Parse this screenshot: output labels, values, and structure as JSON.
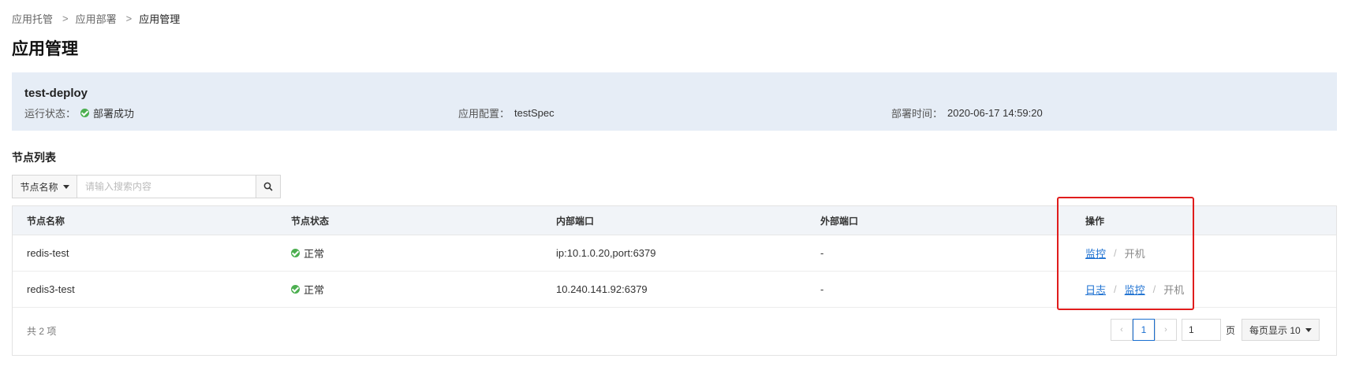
{
  "breadcrumb": {
    "items": [
      "应用托管",
      "应用部署"
    ],
    "separator": ">",
    "current": "应用管理"
  },
  "page_title": "应用管理",
  "summary": {
    "app_name": "test-deploy",
    "status_label": "运行状态：",
    "status_value": "部署成功",
    "config_label": "应用配置：",
    "config_value": "testSpec",
    "time_label": "部署时间：",
    "time_value": "2020-06-17 14:59:20"
  },
  "node_list": {
    "title": "节点列表",
    "search_field": "节点名称",
    "search_placeholder": "请输入搜索内容",
    "columns": [
      "节点名称",
      "节点状态",
      "内部端口",
      "外部端口",
      "操作"
    ],
    "rows": [
      {
        "name": "redis-test",
        "status": "正常",
        "internal_port": "ip:10.1.0.20,port:6379",
        "external_port": "-",
        "actions": [
          {
            "label": "监控",
            "enabled": true
          },
          {
            "label": "开机",
            "enabled": false
          }
        ]
      },
      {
        "name": "redis3-test",
        "status": "正常",
        "internal_port": "10.240.141.92:6379",
        "external_port": "-",
        "actions": [
          {
            "label": "日志",
            "enabled": true
          },
          {
            "label": "监控",
            "enabled": true
          },
          {
            "label": "开机",
            "enabled": false
          }
        ]
      }
    ],
    "action_separator": "/",
    "total_text": "共 2 项"
  },
  "pagination": {
    "prev": "‹",
    "current": "1",
    "next": "›",
    "jump_value": "1",
    "page_label": "页",
    "page_size_text": "每页显示 10"
  },
  "colors": {
    "accent": "#1a6fd1",
    "success": "#4caf50",
    "highlight": "#e01c1c",
    "summary_bg": "#e6edf6"
  }
}
